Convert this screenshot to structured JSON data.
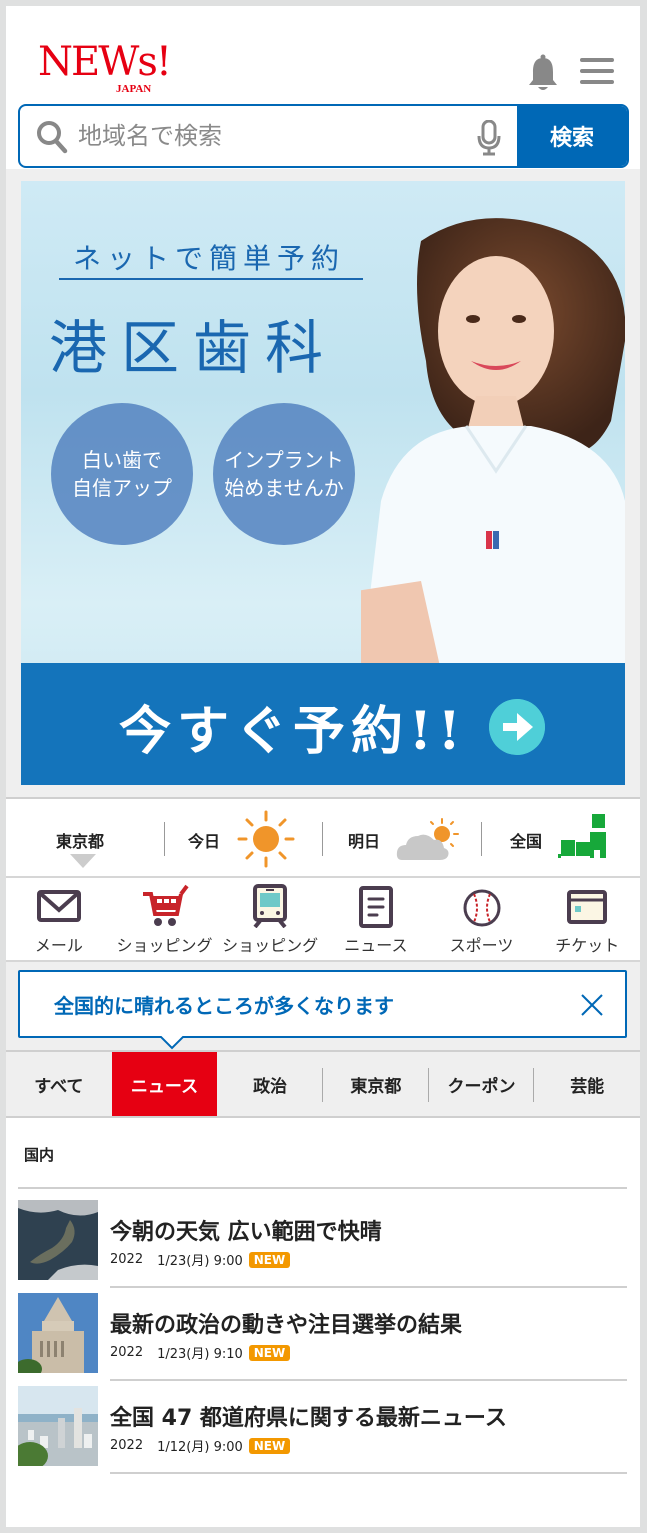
{
  "header": {
    "logo_main": "NEWs!",
    "logo_sub": "JAPAN",
    "bell_icon": "bell-icon",
    "menu_icon": "hamburger-menu-icon"
  },
  "search": {
    "placeholder": "地域名で検索",
    "value": "",
    "button_label": "検索",
    "search_icon": "search-icon",
    "mic_icon": "microphone-icon"
  },
  "banner": {
    "lead": "ネットで簡単予約",
    "title": "港区歯科",
    "circle1": [
      "白い歯で",
      "自信アップ"
    ],
    "circle2": [
      "インプラント",
      "始めませんか"
    ],
    "cta": "今すぐ予約!!",
    "cta_icon": "arrow-right-circle-icon"
  },
  "weather": {
    "region": "東京都",
    "region_icon": "triangle-down-icon",
    "today_label": "今日",
    "today_icon": "sunny-icon",
    "tomorrow_label": "明日",
    "tomorrow_icon": "cloudy-sunny-icon",
    "national_label": "全国",
    "national_icon": "japan-map-icon"
  },
  "services": [
    {
      "label": "メール",
      "icon": "mail-icon"
    },
    {
      "label": "ショッピング",
      "icon": "shopping-cart-icon"
    },
    {
      "label": "ショッピング",
      "icon": "train-icon"
    },
    {
      "label": "ニュース",
      "icon": "document-icon"
    },
    {
      "label": "スポーツ",
      "icon": "baseball-icon"
    },
    {
      "label": "チケット",
      "icon": "ticket-card-icon"
    }
  ],
  "notice": {
    "text": "全国的に晴れるところが多くなります",
    "close_icon": "close-icon"
  },
  "tabs": [
    {
      "label": "すべて",
      "active": false
    },
    {
      "label": "ニュース",
      "active": true
    },
    {
      "label": "政治",
      "active": false
    },
    {
      "label": "東京都",
      "active": false
    },
    {
      "label": "クーポン",
      "active": false
    },
    {
      "label": "芸能",
      "active": false
    }
  ],
  "news": {
    "section_title": "国内",
    "items": [
      {
        "headline": "今朝の天気 広い範囲で快晴",
        "year": "2022",
        "date": "1/23(月) 9:00",
        "badge": "NEW",
        "thumb": "satellite-japan-thumbnail"
      },
      {
        "headline": "最新の政治の動きや注目選挙の結果",
        "year": "2022",
        "date": "1/23(月) 9:10",
        "badge": "NEW",
        "thumb": "diet-building-thumbnail"
      },
      {
        "headline": "全国 47 都道府県に関する最新ニュース",
        "year": "2022",
        "date": "1/12(月) 9:00",
        "badge": "NEW",
        "thumb": "cityscape-thumbnail"
      }
    ]
  },
  "colors": {
    "brand_red": "#e60012",
    "primary_blue": "#0068b6",
    "badge_orange": "#f39800",
    "sun_orange": "#f0952a",
    "map_green": "#17a83a"
  }
}
